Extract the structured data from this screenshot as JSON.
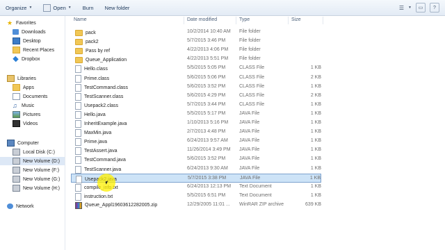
{
  "toolbar": {
    "organize": "Organize",
    "open": "Open",
    "burn": "Burn",
    "new_folder": "New folder"
  },
  "nav": {
    "favorites": "Favorites",
    "downloads": "Downloads",
    "desktop": "Desktop",
    "recent_places": "Recent Places",
    "dropbox": "Dropbox",
    "libraries": "Libraries",
    "apps": "Apps",
    "documents": "Documents",
    "music": "Music",
    "pictures": "Pictures",
    "videos": "Videos",
    "computer": "Computer",
    "local_disk_c": "Local Disk (C:)",
    "new_volume_d": "New Volume (D:)",
    "new_volume_f": "New Volume (F:)",
    "new_volume_g": "New Volume (G:)",
    "new_volume_h": "New Volume (H:)",
    "network": "Network"
  },
  "columns": {
    "name": "Name",
    "date": "Date modified",
    "type": "Type",
    "size": "Size"
  },
  "files": [
    {
      "name": "pack",
      "date": "10/2/2014 10:40 AM",
      "type": "File folder",
      "size": "",
      "icon": "folder"
    },
    {
      "name": "pack2",
      "date": "5/7/2015 3:46 PM",
      "type": "File folder",
      "size": "",
      "icon": "folder"
    },
    {
      "name": "Pass by ref",
      "date": "4/22/2013 4:06 PM",
      "type": "File folder",
      "size": "",
      "icon": "folder"
    },
    {
      "name": "Queue_Application",
      "date": "4/22/2013 5:51 PM",
      "type": "File folder",
      "size": "",
      "icon": "folder"
    },
    {
      "name": "Hello.class",
      "date": "5/5/2015 5:05 PM",
      "type": "CLASS File",
      "size": "1 KB",
      "icon": "doc"
    },
    {
      "name": "Prime.class",
      "date": "5/6/2015 5:06 PM",
      "type": "CLASS File",
      "size": "2 KB",
      "icon": "doc"
    },
    {
      "name": "TestCommand.class",
      "date": "5/6/2015 3:52 PM",
      "type": "CLASS File",
      "size": "1 KB",
      "icon": "doc"
    },
    {
      "name": "TestScanner.class",
      "date": "5/6/2015 4:29 PM",
      "type": "CLASS File",
      "size": "2 KB",
      "icon": "doc"
    },
    {
      "name": "Usepack2.class",
      "date": "5/7/2015 3:44 PM",
      "type": "CLASS File",
      "size": "1 KB",
      "icon": "doc"
    },
    {
      "name": "Hello.java",
      "date": "5/5/2015 5:17 PM",
      "type": "JAVA File",
      "size": "1 KB",
      "icon": "doc"
    },
    {
      "name": "InheritExample.java",
      "date": "1/10/2013 5:16 PM",
      "type": "JAVA File",
      "size": "1 KB",
      "icon": "doc"
    },
    {
      "name": "MaxMin.java",
      "date": "2/7/2013 4:48 PM",
      "type": "JAVA File",
      "size": "1 KB",
      "icon": "doc"
    },
    {
      "name": "Prime.java",
      "date": "6/24/2013 9:57 AM",
      "type": "JAVA File",
      "size": "1 KB",
      "icon": "doc"
    },
    {
      "name": "TestAssert.java",
      "date": "11/26/2014 3:49 PM",
      "type": "JAVA File",
      "size": "1 KB",
      "icon": "doc"
    },
    {
      "name": "TestCommand.java",
      "date": "5/6/2015 3:52 PM",
      "type": "JAVA File",
      "size": "1 KB",
      "icon": "doc"
    },
    {
      "name": "TestScanner.java",
      "date": "6/24/2013 9:30 AM",
      "type": "JAVA File",
      "size": "1 KB",
      "icon": "doc"
    },
    {
      "name": "Usepack2.java",
      "date": "5/7/2015 3:38 PM",
      "type": "JAVA File",
      "size": "1 KB",
      "icon": "doc",
      "selected": true
    },
    {
      "name": "compile_info.txt",
      "date": "6/24/2013 12:13 PM",
      "type": "Text Document",
      "size": "1 KB",
      "icon": "doc"
    },
    {
      "name": "instruction.txt",
      "date": "5/5/2015 6:51 PM",
      "type": "Text Document",
      "size": "1 KB",
      "icon": "doc"
    },
    {
      "name": "Queue_Appl19603612282005.zip",
      "date": "12/29/2005 11:01 ...",
      "type": "WinRAR ZIP archive",
      "size": "639 KB",
      "icon": "zip"
    }
  ]
}
